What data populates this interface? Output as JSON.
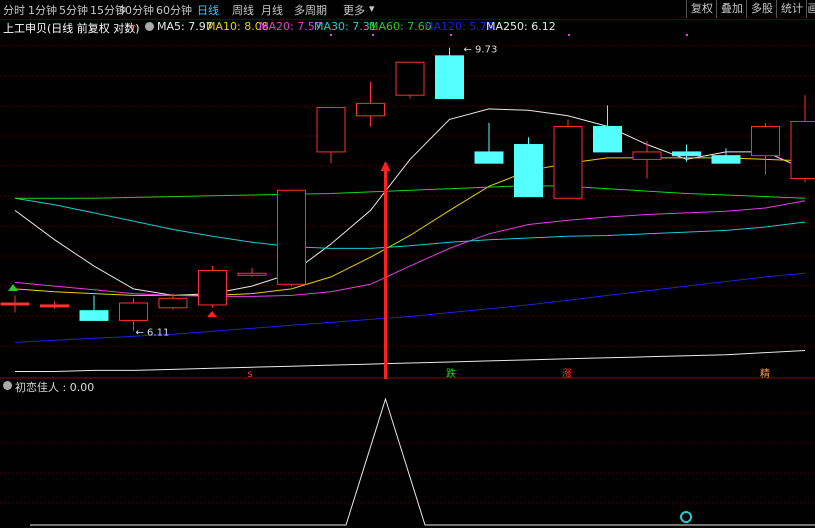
{
  "toolbar": {
    "periods": [
      "分时",
      "1分钟",
      "5分钟",
      "15分钟",
      "30分钟",
      "60分钟",
      "日线",
      "周线",
      "月线",
      "多周期",
      "更多"
    ],
    "active_period": "日线",
    "more_arrow": "▾",
    "buttons": [
      "复权",
      "叠加",
      "多股",
      "统计",
      "画"
    ]
  },
  "legend": {
    "title": "上工申贝(日线 前复权 对数)",
    "ma": [
      {
        "label": "MA5: 7.97",
        "color": "#e8e8e8"
      },
      {
        "label": "MA10: 8.08",
        "color": "#e8d000"
      },
      {
        "label": "MA20: 7.57",
        "color": "#e040e0"
      },
      {
        "label": "MA30: 7.31",
        "color": "#20c8d0"
      },
      {
        "label": "MA60: 7.60",
        "color": "#20d020"
      },
      {
        "label": "MA120: 5.78",
        "color": "#2020e0"
      },
      {
        "label": "MA250: 6.12",
        "color": "#e8e8e8"
      }
    ]
  },
  "annotations": {
    "high_label": "9.73",
    "low_label": "6.11",
    "marker_s": "s",
    "marker_die": "跌",
    "marker_zhang": "涨",
    "marker_jing": "精"
  },
  "indicator": {
    "label": "初恋佳人 : 0.00"
  },
  "colors": {
    "up": "#ff3030",
    "down": "#54ffff",
    "signal": "#ff2020",
    "grid": "#5a0000"
  },
  "chart_data": {
    "type": "candlestick",
    "ohlc": [
      {
        "o": 6.4,
        "h": 6.48,
        "l": 6.3,
        "c": 6.4
      },
      {
        "o": 6.38,
        "h": 6.42,
        "l": 6.34,
        "c": 6.38
      },
      {
        "o": 6.32,
        "h": 6.48,
        "l": 6.22,
        "c": 6.22
      },
      {
        "o": 6.22,
        "h": 6.45,
        "l": 6.11,
        "c": 6.4
      },
      {
        "o": 6.35,
        "h": 6.5,
        "l": 6.33,
        "c": 6.45
      },
      {
        "o": 6.38,
        "h": 6.8,
        "l": 6.35,
        "c": 6.75
      },
      {
        "o": 6.7,
        "h": 6.78,
        "l": 6.68,
        "c": 6.72
      },
      {
        "o": 6.6,
        "h": 7.7,
        "l": 6.58,
        "c": 7.7
      },
      {
        "o": 8.2,
        "h": 8.82,
        "l": 8.05,
        "c": 8.82
      },
      {
        "o": 8.7,
        "h": 9.2,
        "l": 8.55,
        "c": 8.88
      },
      {
        "o": 9.0,
        "h": 9.45,
        "l": 8.95,
        "c": 9.5
      },
      {
        "o": 9.6,
        "h": 9.73,
        "l": 9.5,
        "c": 8.95
      },
      {
        "o": 8.2,
        "h": 8.6,
        "l": 8.1,
        "c": 8.05
      },
      {
        "o": 8.3,
        "h": 8.4,
        "l": 7.7,
        "c": 7.62
      },
      {
        "o": 7.6,
        "h": 8.65,
        "l": 7.6,
        "c": 8.55
      },
      {
        "o": 8.55,
        "h": 8.85,
        "l": 8.45,
        "c": 8.2
      },
      {
        "o": 8.1,
        "h": 8.35,
        "l": 7.85,
        "c": 8.2
      },
      {
        "o": 8.2,
        "h": 8.3,
        "l": 8.07,
        "c": 8.15
      },
      {
        "o": 8.15,
        "h": 8.25,
        "l": 8.05,
        "c": 8.05
      },
      {
        "o": 8.15,
        "h": 8.6,
        "l": 7.9,
        "c": 8.55
      },
      {
        "o": 7.85,
        "h": 9.0,
        "l": 7.8,
        "c": 8.62
      }
    ],
    "ma": [
      {
        "name": "MA5",
        "values": [
          7.45,
          7.1,
          6.8,
          6.55,
          6.48,
          6.5,
          6.58,
          6.72,
          7.05,
          7.45,
          8.1,
          8.65,
          8.8,
          8.78,
          8.7,
          8.55,
          8.3,
          8.1,
          8.2,
          8.2,
          7.97
        ]
      },
      {
        "name": "MA10",
        "values": [
          6.55,
          6.52,
          6.5,
          6.48,
          6.48,
          6.48,
          6.5,
          6.55,
          6.68,
          6.9,
          7.15,
          7.45,
          7.75,
          7.95,
          8.05,
          8.12,
          8.12,
          8.12,
          8.12,
          8.1,
          8.08
        ]
      },
      {
        "name": "MA20",
        "values": [
          6.62,
          6.58,
          6.54,
          6.5,
          6.48,
          6.47,
          6.47,
          6.48,
          6.52,
          6.6,
          6.8,
          7.0,
          7.17,
          7.28,
          7.33,
          7.37,
          7.4,
          7.42,
          7.44,
          7.48,
          7.57
        ]
      },
      {
        "name": "MA30",
        "values": [
          7.6,
          7.52,
          7.42,
          7.32,
          7.22,
          7.14,
          7.07,
          7.02,
          7.0,
          7.0,
          7.03,
          7.07,
          7.1,
          7.12,
          7.14,
          7.15,
          7.17,
          7.19,
          7.21,
          7.25,
          7.31
        ]
      },
      {
        "name": "MA60",
        "values": [
          7.6,
          7.6,
          7.6,
          7.61,
          7.62,
          7.63,
          7.64,
          7.65,
          7.66,
          7.68,
          7.7,
          7.72,
          7.74,
          7.76,
          7.75,
          7.72,
          7.69,
          7.66,
          7.64,
          7.62,
          7.6
        ]
      },
      {
        "name": "MA120",
        "values": [
          6.0,
          6.02,
          6.04,
          6.06,
          6.08,
          6.11,
          6.14,
          6.17,
          6.2,
          6.23,
          6.26,
          6.3,
          6.34,
          6.38,
          6.43,
          6.48,
          6.53,
          6.58,
          6.63,
          6.68,
          6.72
        ]
      },
      {
        "name": "MA250",
        "values": [
          5.72,
          5.72,
          5.73,
          5.73,
          5.74,
          5.75,
          5.76,
          5.77,
          5.78,
          5.79,
          5.8,
          5.81,
          5.82,
          5.83,
          5.84,
          5.85,
          5.86,
          5.87,
          5.88,
          5.9,
          5.92
        ]
      }
    ],
    "signal_index": 9,
    "indicator_values": [
      0,
      0,
      0,
      0,
      0,
      0,
      0,
      0,
      0,
      1,
      0,
      0,
      0,
      0,
      0,
      0,
      0,
      0,
      0,
      0,
      0
    ],
    "yscale": "log",
    "ylim": [
      5.65,
      9.95
    ],
    "grid": true
  }
}
